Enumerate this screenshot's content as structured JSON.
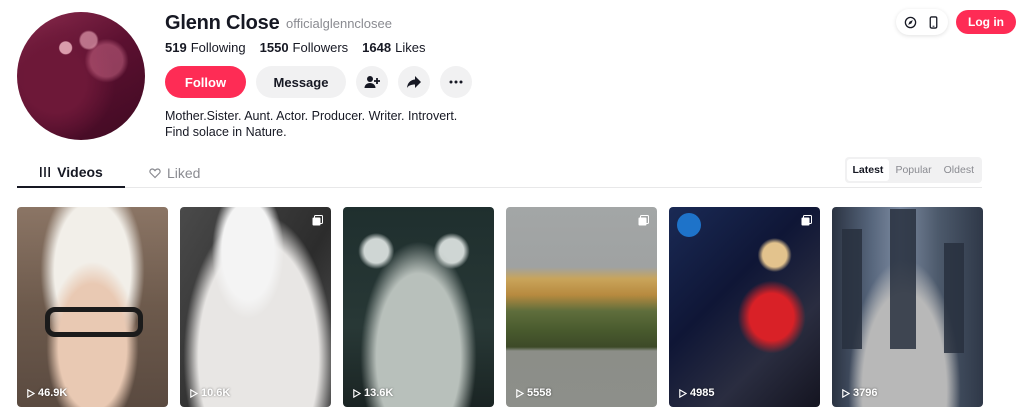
{
  "profile": {
    "name": "Glenn Close",
    "username": "officialglennclosee",
    "stats": [
      {
        "value": "519",
        "label": "Following"
      },
      {
        "value": "1550",
        "label": "Followers"
      },
      {
        "value": "1648",
        "label": "Likes"
      }
    ],
    "bio_line1": "Mother.Sister. Aunt. Actor. Producer. Writer. Introvert.",
    "bio_line2": "Find solace in Nature."
  },
  "actions": {
    "follow_label": "Follow",
    "message_label": "Message"
  },
  "topbar": {
    "login_label": "Log in"
  },
  "tabs": {
    "videos_label": "Videos",
    "liked_label": "Liked"
  },
  "sort": {
    "options": [
      "Latest",
      "Popular",
      "Oldest"
    ],
    "selected": "Latest"
  },
  "videos": [
    {
      "views": "46.9K",
      "multi": false
    },
    {
      "views": "10.6K",
      "multi": true
    },
    {
      "views": "13.6K",
      "multi": false
    },
    {
      "views": "5558",
      "multi": true
    },
    {
      "views": "4985",
      "multi": true
    },
    {
      "views": "3796",
      "multi": false
    }
  ],
  "colors": {
    "accent": "#fe2c55",
    "text": "#161823",
    "muted": "#8a8b91"
  }
}
